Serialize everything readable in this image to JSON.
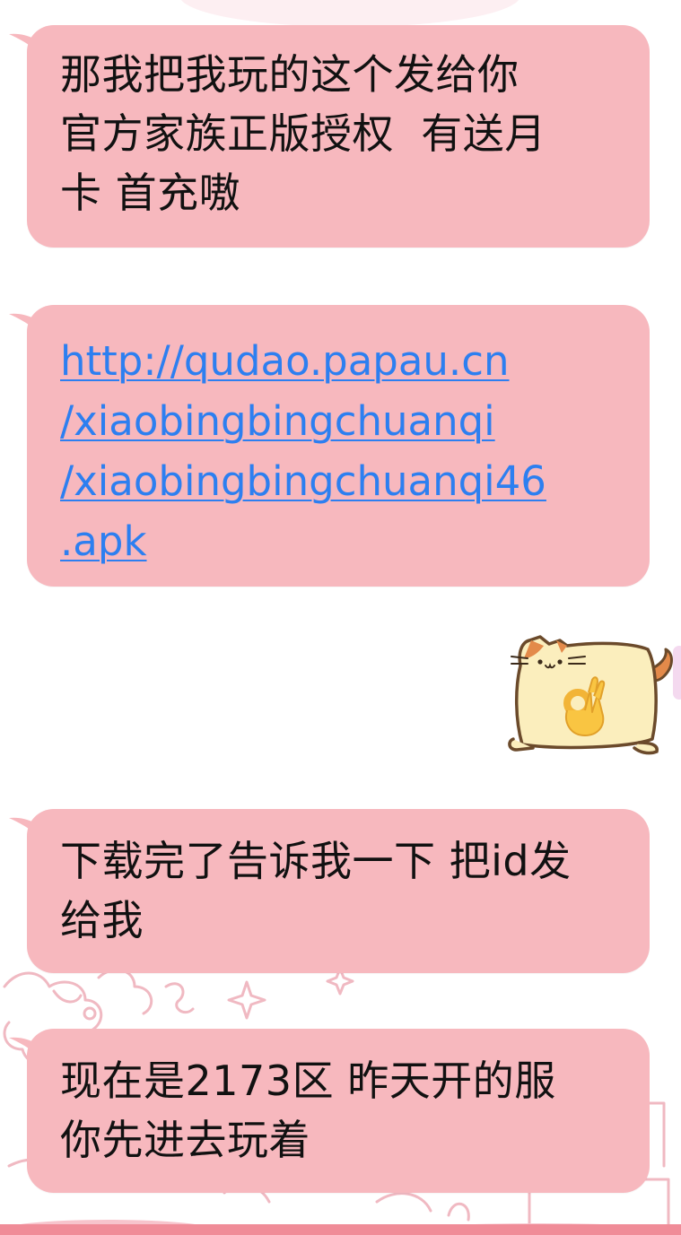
{
  "messages": [
    {
      "id": "m1",
      "text": "那我把我玩的这个发给你\n官方家族正版授权  有送月\n卡 首充嗷",
      "bubble_color": "#f7b8be"
    },
    {
      "id": "m2",
      "link": "http://qudao.papau.cn\n/xiaobingbingchuanqi\n/xiaobingbingchuanqi46\n.apk",
      "link_color": "#2d7ff0",
      "bubble_color": "#f7b8be"
    },
    {
      "id": "m3",
      "sticker": "cat-ok-hand-sticker"
    },
    {
      "id": "m4",
      "text": "下载完了告诉我一下 把id发\n给我",
      "bubble_color": "#f7b8be"
    },
    {
      "id": "m5",
      "text": "现在是2173区 昨天开的服\n你先进去玩着",
      "bubble_color": "#f7b8be"
    }
  ]
}
